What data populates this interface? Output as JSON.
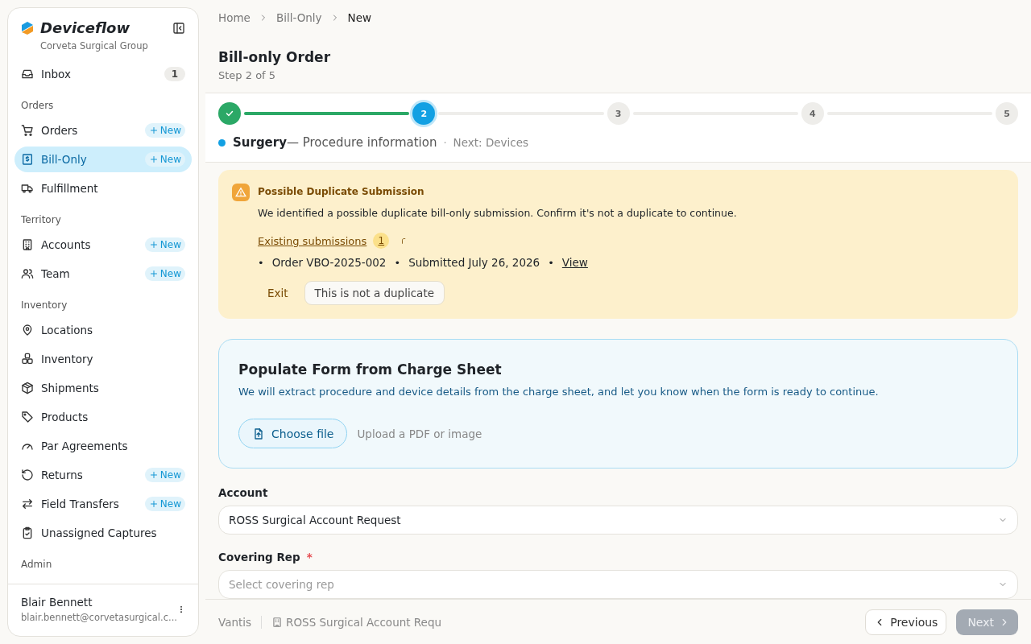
{
  "sidebar": {
    "brand": "Deviceflow",
    "organization": "Corveta Surgical Group",
    "inbox": {
      "label": "Inbox",
      "count": "1",
      "selected": false
    },
    "sections": [
      {
        "title": "Orders",
        "items": [
          {
            "label": "Orders",
            "selected": false,
            "action": "New"
          },
          {
            "label": "Bill-Only",
            "selected": true,
            "action": "New"
          },
          {
            "label": "Fulfillment",
            "selected": false
          }
        ]
      },
      {
        "title": "Territory",
        "items": [
          {
            "label": "Accounts",
            "selected": false,
            "action": "New"
          },
          {
            "label": "Team",
            "selected": false,
            "action": "New"
          }
        ]
      },
      {
        "title": "Inventory",
        "items": [
          {
            "label": "Locations",
            "selected": false
          },
          {
            "label": "Inventory",
            "selected": false
          },
          {
            "label": "Shipments",
            "selected": false
          },
          {
            "label": "Products",
            "selected": false
          },
          {
            "label": "Par Agreements",
            "selected": false
          },
          {
            "label": "Returns",
            "selected": false,
            "action": "New"
          },
          {
            "label": "Field Transfers",
            "selected": false,
            "action": "New"
          },
          {
            "label": "Unassigned Captures",
            "selected": false
          }
        ]
      },
      {
        "title": "Admin"
      }
    ],
    "user": {
      "name": "Blair Bennett",
      "email": "blair.bennett@corvetasurgical.c..."
    }
  },
  "breadcrumb": [
    "Home",
    "Bill-Only",
    "New"
  ],
  "page": {
    "title": "Bill-only Order",
    "subtitle": "Step 2 of 5"
  },
  "stepper": {
    "steps": [
      {
        "done": true,
        "selected": false
      },
      {
        "label": "2",
        "done": false,
        "selected": true
      },
      {
        "label": "3",
        "done": false,
        "selected": false
      },
      {
        "label": "4",
        "done": false,
        "selected": false
      },
      {
        "label": "5",
        "done": false,
        "selected": false
      }
    ],
    "current_name": "Surgery",
    "current_detail": "— Procedure information",
    "separator": "·",
    "next": "Next: Devices"
  },
  "alert": {
    "title": "Possible Duplicate Submission",
    "message": "We identified a possible duplicate bill-only submission. Confirm it's not a duplicate to continue.",
    "link": "Existing submissions",
    "count": "1",
    "submissions": [
      {
        "bullet": "•",
        "order": "Order VBO-2025-002",
        "separator_1": "•",
        "submitted": "Submitted July 26, 2026",
        "separator_2": "•",
        "action": "View"
      }
    ],
    "buttons": [
      "Exit",
      "This is not a duplicate"
    ]
  },
  "upload": {
    "title": "Populate Form from Charge Sheet",
    "message": "We will extract procedure and device details from the charge sheet, and let you know when the form is ready to continue.",
    "button": "Choose file",
    "hint": "Upload a PDF or image"
  },
  "fields": [
    {
      "label": "Account",
      "value": "ROSS Surgical Account Request"
    },
    {
      "label": "Covering Rep",
      "required_mark": "*",
      "placeholder": "Select covering rep"
    }
  ],
  "footer": {
    "company": "Vantis",
    "account": "ROSS Surgical Account Requ",
    "previous": "Previous",
    "next": "Next",
    "next_disabled": true
  }
}
